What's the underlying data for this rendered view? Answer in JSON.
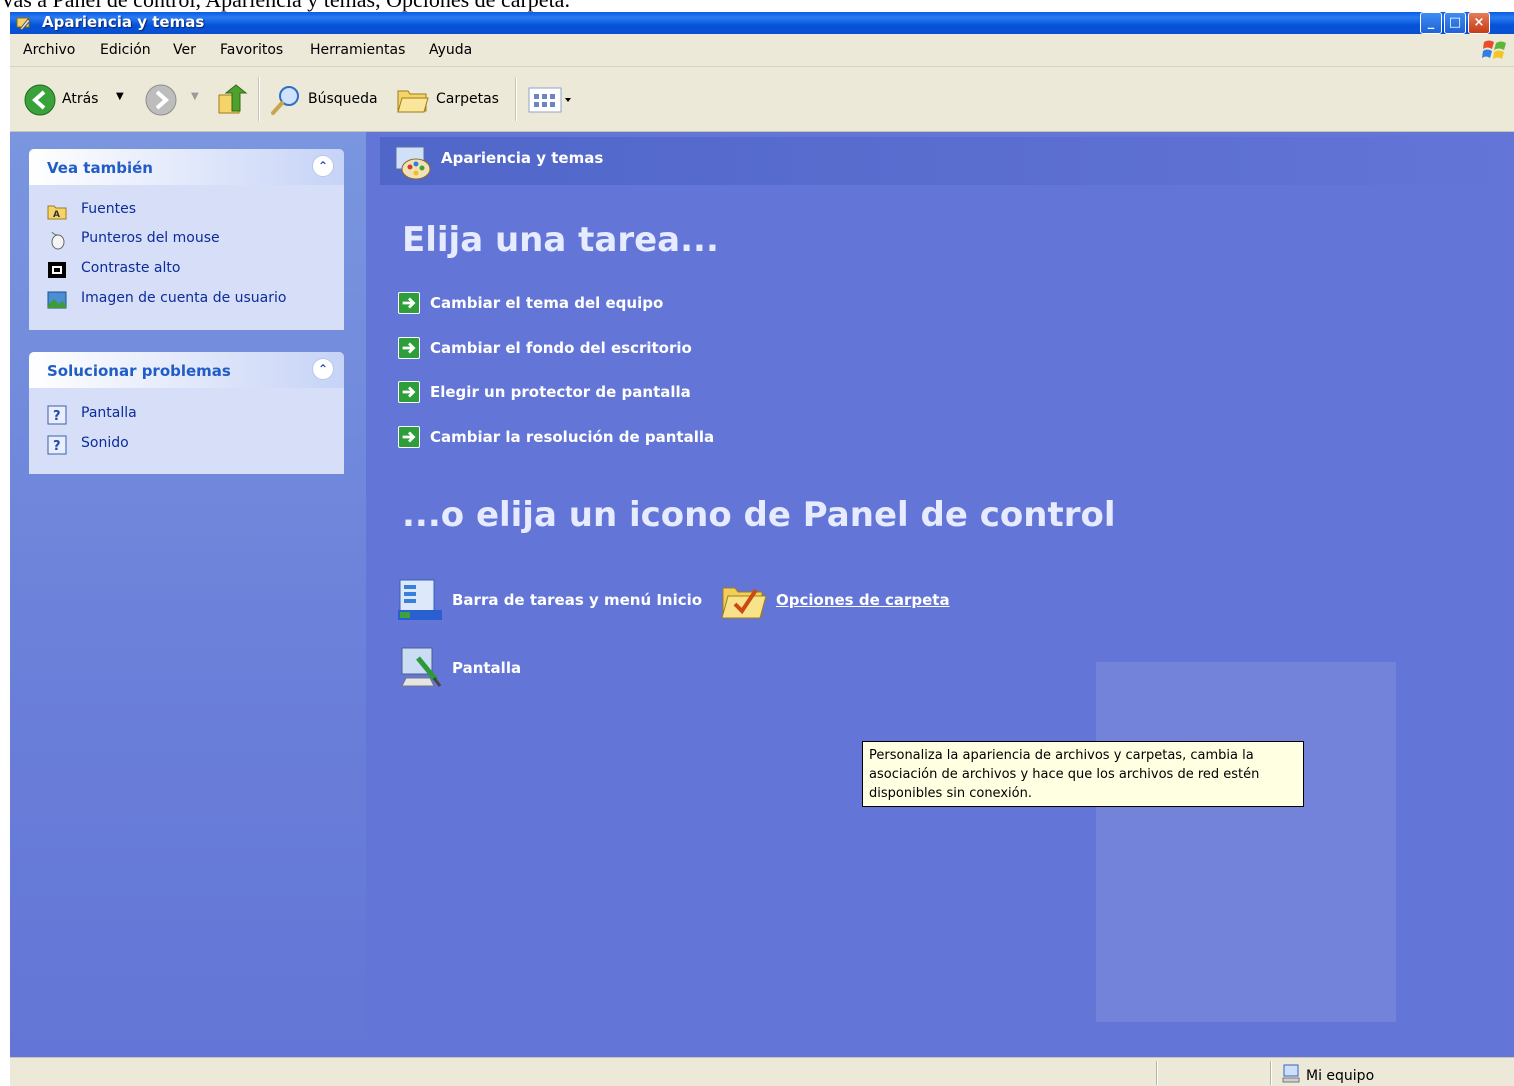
{
  "caption": "Vas a Panel de control, Apariencia y temas, Opciones de carpeta.",
  "window": {
    "title": "Apariencia y temas",
    "controls": [
      "_",
      "□",
      "×"
    ]
  },
  "menubar": [
    "Archivo",
    "Edición",
    "Ver",
    "Favoritos",
    "Herramientas",
    "Ayuda"
  ],
  "toolbar": {
    "back": "Atrás",
    "search": "Búsqueda",
    "folders": "Carpetas"
  },
  "sidebar": {
    "see_also": {
      "title": "Vea también",
      "items": [
        "Fuentes",
        "Punteros del mouse",
        "Contraste alto",
        "Imagen de cuenta de usuario"
      ]
    },
    "troubleshoot": {
      "title": "Solucionar problemas",
      "items": [
        "Pantalla",
        "Sonido"
      ]
    },
    "collapse_glyph": "⌃"
  },
  "main": {
    "banner_title": "Apariencia y temas",
    "heading_task": "Elija una tarea...",
    "tasks": [
      "Cambiar el tema del equipo",
      "Cambiar el fondo del escritorio",
      "Elegir un protector de pantalla",
      "Cambiar la resolución de pantalla"
    ],
    "heading_icon": "...o elija un icono de Panel de control",
    "items": [
      "Barra de tareas y menú Inicio",
      "Opciones de carpeta",
      "Pantalla"
    ]
  },
  "tooltip": "Personaliza la apariencia de archivos y carpetas, cambia la asociación de archivos y hace que los archivos de red estén disponibles sin conexión.",
  "statusbar": {
    "location": "Mi equipo"
  },
  "colors": {
    "titlebar": "#0a5ce6",
    "content_bg": "#6375d6",
    "panel_bg": "#d6dff7",
    "tooltip_bg": "#ffffe1"
  }
}
